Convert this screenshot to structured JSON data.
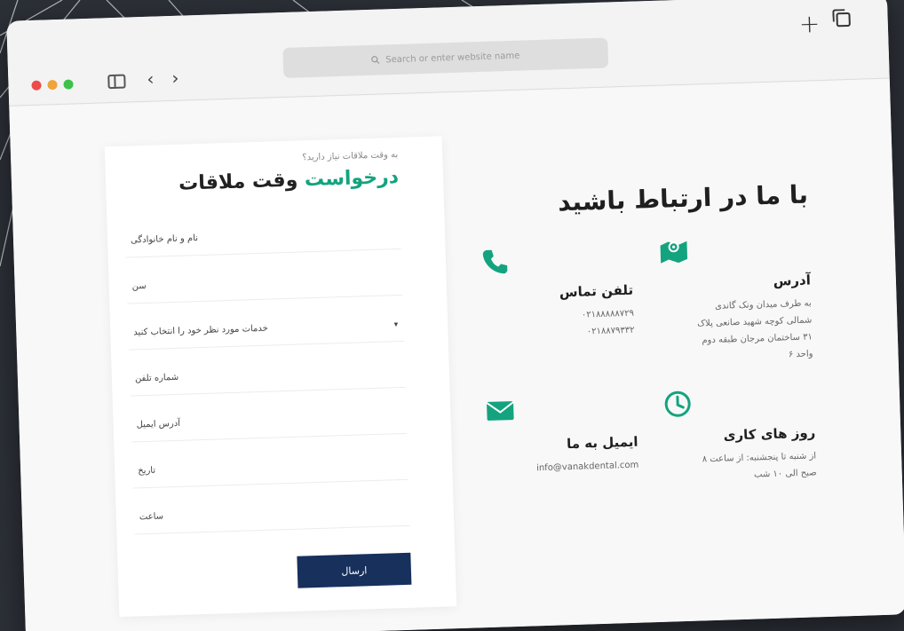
{
  "browser": {
    "address_placeholder": "Search or enter website name",
    "icons": [
      "sidebar-icon",
      "chevron-left-icon",
      "chevron-right-icon",
      "search-icon",
      "plus-icon",
      "tabs-icon"
    ],
    "traffic_lights": [
      "#ed4a4a",
      "#f0a23b",
      "#3ec14b"
    ]
  },
  "form": {
    "question": "به وقت ملاقات نیاز دارید؟",
    "title_accent": "درخواست",
    "title_rest": "وقت ملاقات",
    "fields": {
      "name": "نام و نام خانوادگی",
      "age": "سن",
      "service": "خدمات مورد نظر خود را انتخاب کنید",
      "phone": "شماره تلفن",
      "email": "آدرس ایمیل",
      "date": "تاریخ",
      "time": "ساعت"
    },
    "submit_label": "ارسال"
  },
  "contact": {
    "title": "با ما در ارتباط باشید",
    "address": {
      "title": "آدرس",
      "lines": [
        "به طرف میدان ونک گاندی",
        "شمالی کوچه شهید صانعی پلاک",
        "۳۱ ساختمان مرجان طبقه دوم",
        "واحد ۶"
      ]
    },
    "phone": {
      "title": "تلفن تماس",
      "lines": [
        "۰۲۱۸۸۸۸۸۷۲۹",
        "۰۲۱۸۸۷۹۳۳۲"
      ]
    },
    "hours": {
      "title": "روز های کاری",
      "lines": [
        "از شنبه تا پنجشنبه: از ساعت ۸",
        "صبح الی ۱۰ شب"
      ]
    },
    "email": {
      "title": "ایمیل به ما",
      "value": "info@vanakdental.com"
    }
  },
  "colors": {
    "accent": "#14a37f",
    "button": "#17305c",
    "background": "#2b2f36"
  }
}
